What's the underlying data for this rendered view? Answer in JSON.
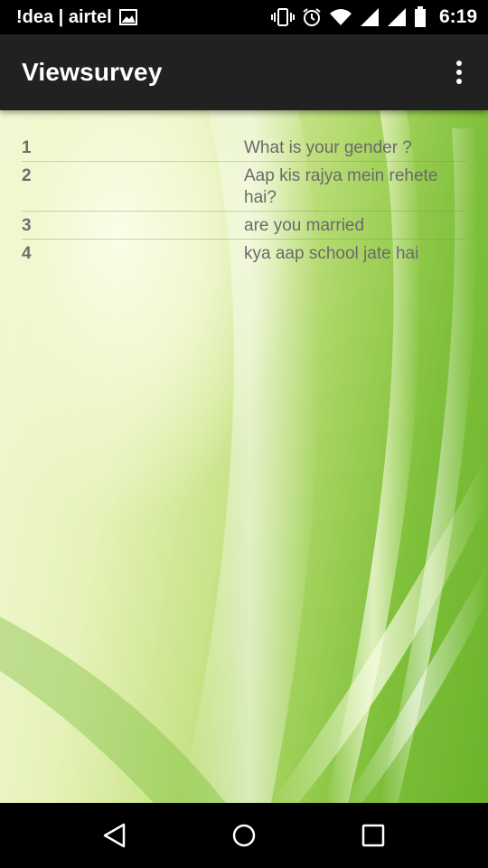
{
  "status_bar": {
    "carrier": "!dea | airtel",
    "time": "6:19",
    "icons": [
      "image-icon",
      "vibrate-icon",
      "alarm-icon",
      "wifi-icon",
      "signal-icon",
      "signal-icon",
      "battery-icon"
    ]
  },
  "app_bar": {
    "title": "Viewsurvey",
    "menu_icon": "overflow-menu-icon"
  },
  "survey": {
    "rows": [
      {
        "num": "1",
        "question": "What is your gender ?"
      },
      {
        "num": "2",
        "question": "Aap kis rajya mein rehete hai?"
      },
      {
        "num": "3",
        "question": "are you married"
      },
      {
        "num": "4",
        "question": "kya aap school jate hai"
      }
    ]
  },
  "nav_bar": {
    "icons": [
      "back-icon",
      "home-icon",
      "recents-icon"
    ]
  },
  "colors": {
    "app_bar": "#212121",
    "text": "#6a6a6a",
    "background_green": "#7fc03a"
  }
}
